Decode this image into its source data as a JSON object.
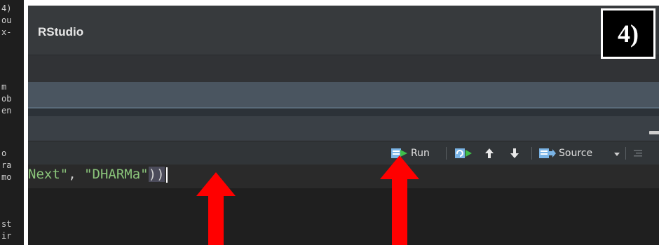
{
  "background_console": {
    "lines": [
      "4)",
      "ou",
      "x-",
      "",
      "m",
      "ob",
      "en",
      "",
      "o",
      "ra",
      "mo",
      "",
      "st",
      "ir"
    ]
  },
  "window": {
    "title": "RStudio",
    "step_label": "4)"
  },
  "pane": {
    "controls": [
      "minimize-icon",
      "maximize-icon"
    ]
  },
  "toolbar": {
    "run_label": "Run",
    "source_label": "Source",
    "icons": [
      "run-icon",
      "rerun-icon",
      "go-up-icon",
      "go-down-icon",
      "source-icon",
      "dropdown-icon",
      "outline-icon"
    ]
  },
  "editor": {
    "code_str1": "Next\"",
    "code_sep": ", ",
    "code_str2": "\"DHARMa\"",
    "code_paren1": ")",
    "code_paren2": ")"
  },
  "annotations": {
    "arrow_color": "#ff0000",
    "arrows": [
      "arrow-to-cursor",
      "arrow-to-run-button"
    ]
  },
  "colors": {
    "accent_green": "#3fbf4a",
    "icon_blue": "#7ab4e6"
  }
}
